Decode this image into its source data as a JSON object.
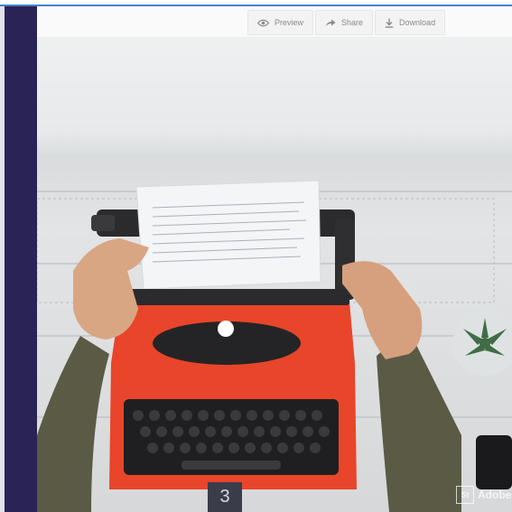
{
  "toolbar": {
    "buttons": [
      {
        "label": "Preview",
        "icon": "eye-icon"
      },
      {
        "label": "Share",
        "icon": "share-arrow-icon"
      },
      {
        "label": "Download",
        "icon": "download-icon"
      }
    ]
  },
  "slide": {
    "page_number": "3",
    "watermark": {
      "mark": "St",
      "text": "Adobe"
    }
  },
  "colors": {
    "sidebar": "#2a2356",
    "typewriter": "#e8452a",
    "sleeve": "#5b5a45",
    "accent_line": "#4a7fd0"
  }
}
